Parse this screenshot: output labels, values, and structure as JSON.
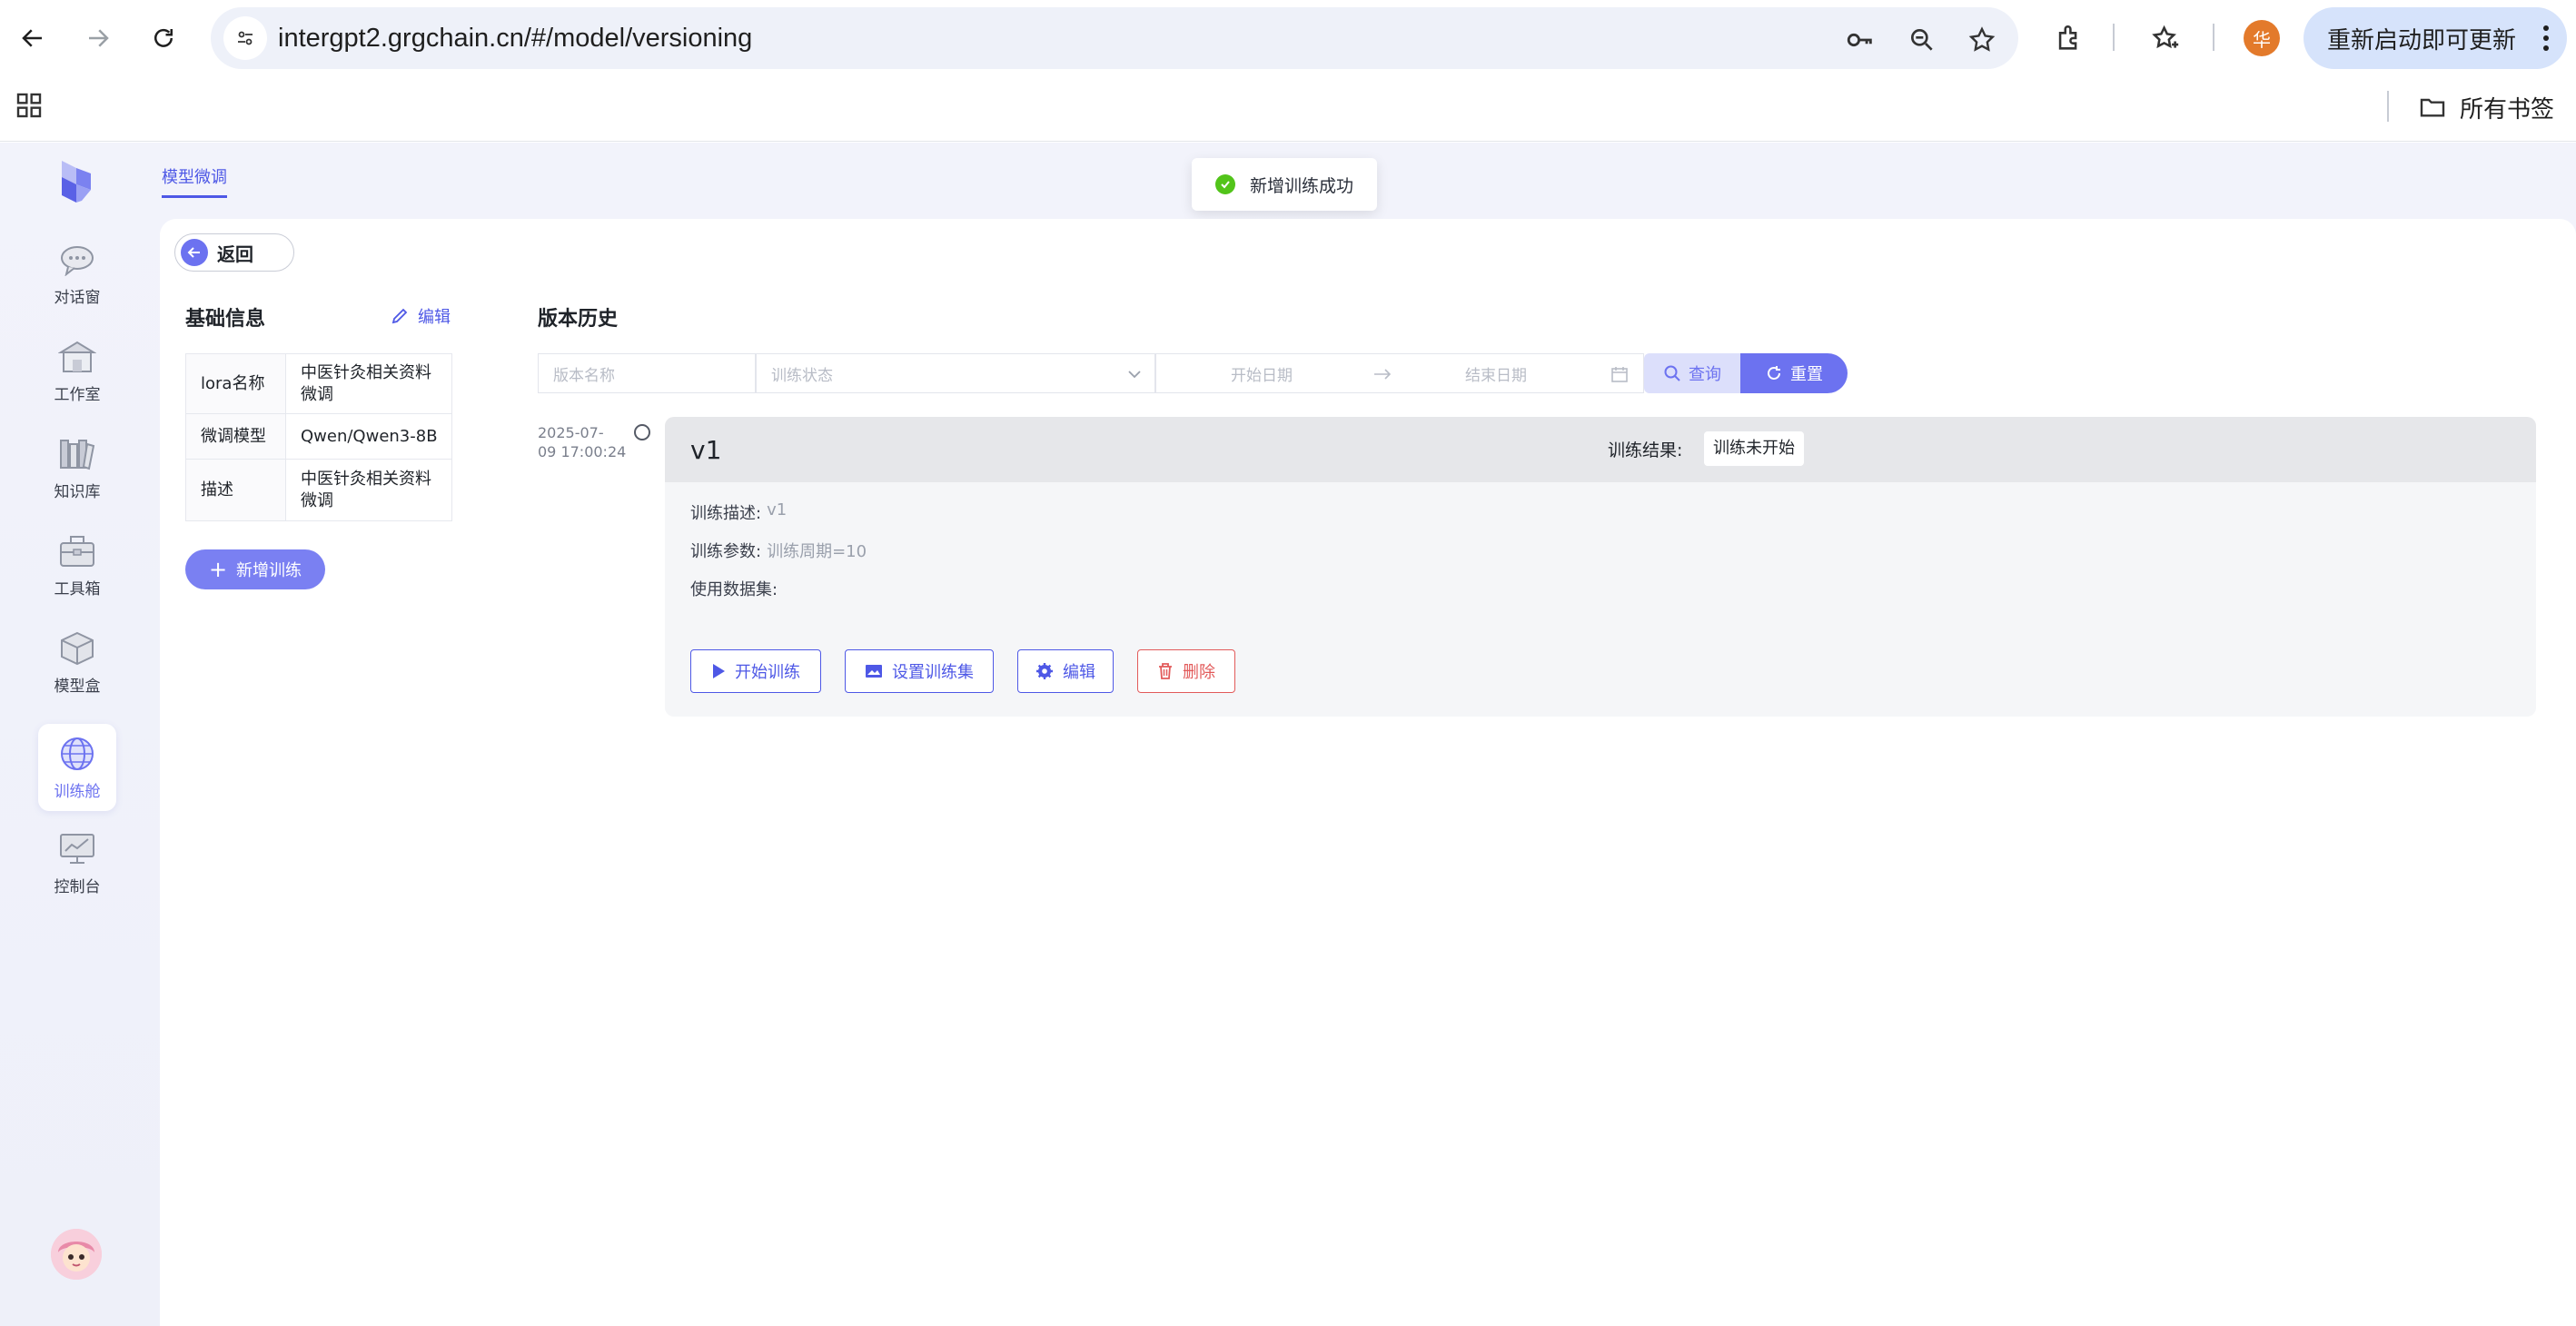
{
  "browser": {
    "url": "intergpt2.grgchain.cn/#/model/versioning",
    "profile_initial": "华",
    "update_button": "重新启动即可更新",
    "all_bookmarks": "所有书签"
  },
  "sidebar": {
    "items": [
      {
        "label": "对话窗",
        "icon": "chat-bubble-icon"
      },
      {
        "label": "工作室",
        "icon": "studio-house-icon"
      },
      {
        "label": "知识库",
        "icon": "books-icon"
      },
      {
        "label": "工具箱",
        "icon": "toolbox-icon"
      },
      {
        "label": "模型盒",
        "icon": "model-box-icon"
      },
      {
        "label": "训练舱",
        "icon": "training-globe-icon",
        "active": true
      },
      {
        "label": "控制台",
        "icon": "monitor-chart-icon"
      }
    ]
  },
  "tabs": {
    "active": "模型微调"
  },
  "toast": {
    "message": "新增训练成功"
  },
  "back_label": "返回",
  "basic_info": {
    "title": "基础信息",
    "edit_label": "编辑",
    "rows": [
      {
        "key": "lora名称",
        "value": "中医针灸相关资料微调"
      },
      {
        "key": "微调模型",
        "value": "Qwen/Qwen3-8B"
      },
      {
        "key": "描述",
        "value": "中医针灸相关资料微调"
      }
    ],
    "add_button": "新增训练"
  },
  "history": {
    "title": "版本历史",
    "filters": {
      "version_name_placeholder": "版本名称",
      "status_placeholder": "训练状态",
      "start_date_placeholder": "开始日期",
      "end_date_placeholder": "结束日期",
      "query_label": "查询",
      "reset_label": "重置"
    },
    "entries": [
      {
        "time_line1": "2025-07-",
        "time_line2": "09 17:00:24",
        "version": "v1",
        "result_label": "训练结果:",
        "result_value": "训练未开始",
        "desc_label": "训练描述:",
        "desc_value": "v1",
        "params_label": "训练参数:",
        "params_value": "训练周期=10",
        "dataset_label": "使用数据集:",
        "dataset_value": "",
        "actions": {
          "start": "开始训练",
          "set_dataset": "设置训练集",
          "edit": "编辑",
          "delete": "删除"
        }
      }
    ]
  },
  "colors": {
    "accent": "#6c72f0",
    "link": "#4e58e6",
    "danger": "#e25a5a",
    "success": "#52c41a"
  }
}
